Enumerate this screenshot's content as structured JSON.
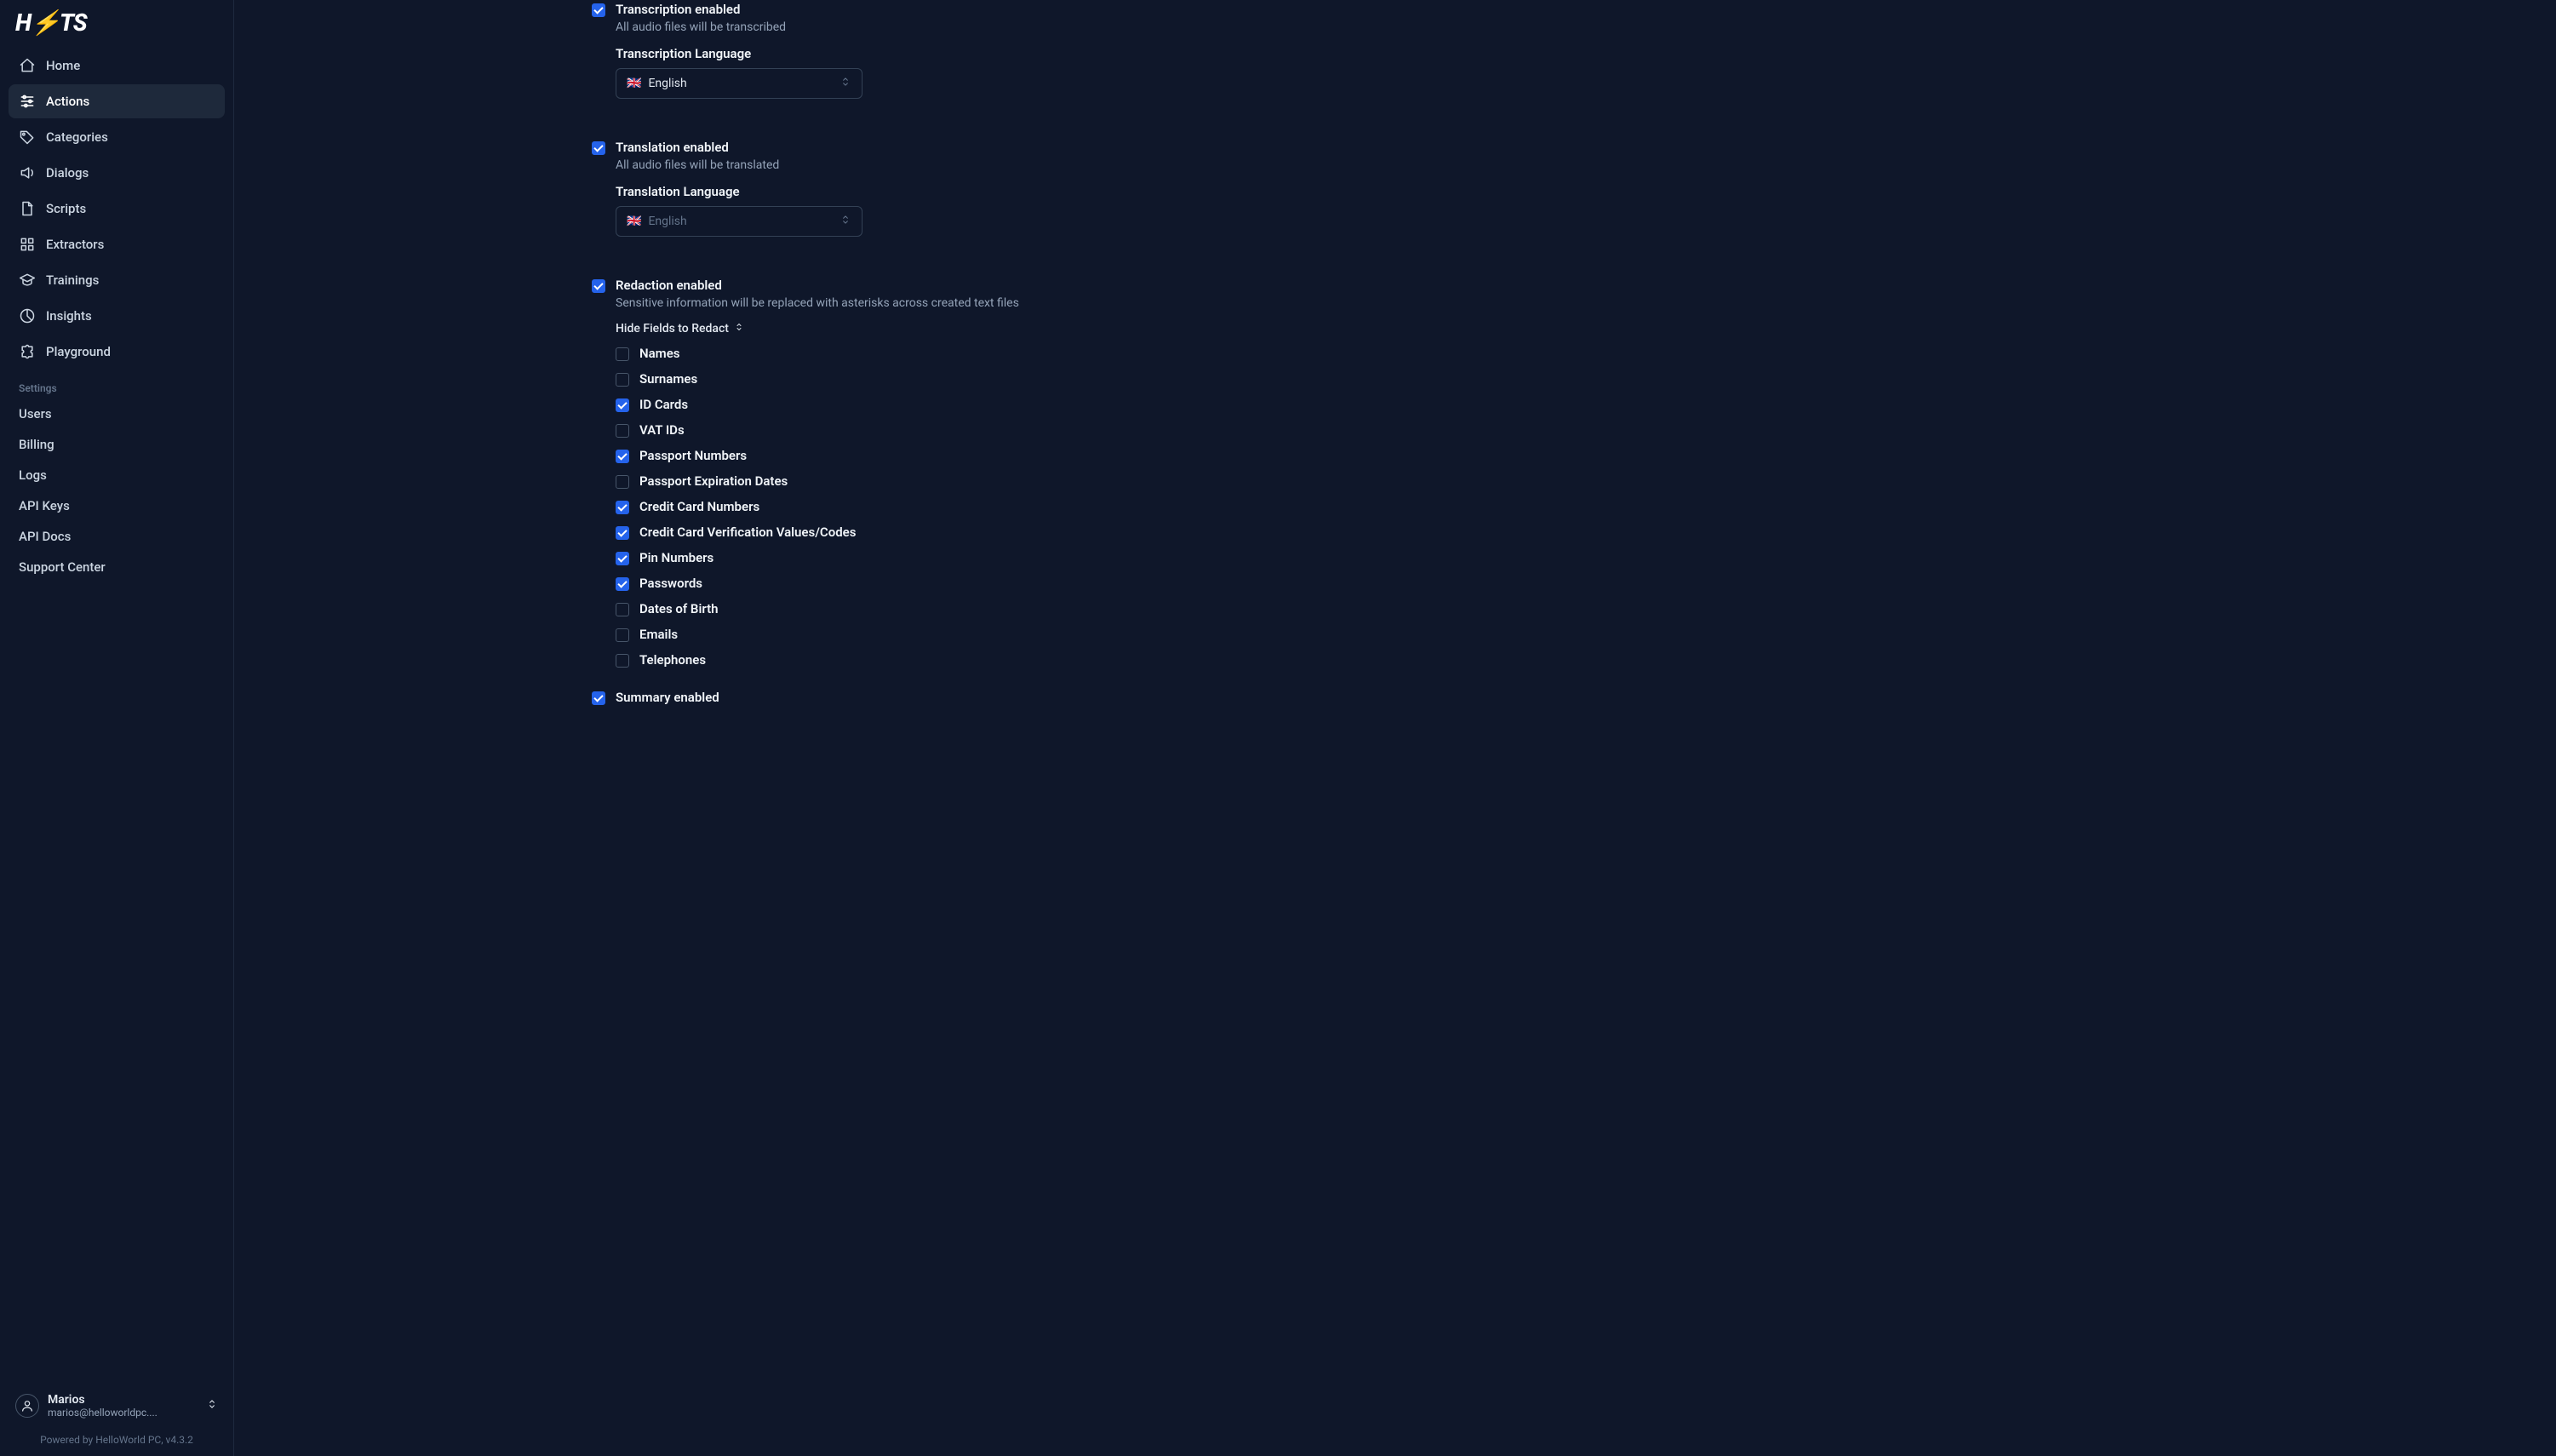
{
  "logo": "H⚡TS",
  "sidebar": {
    "main": [
      {
        "label": "Home",
        "icon": "home-icon",
        "active": false
      },
      {
        "label": "Actions",
        "icon": "sliders-icon",
        "active": true
      },
      {
        "label": "Categories",
        "icon": "tag-icon",
        "active": false
      },
      {
        "label": "Dialogs",
        "icon": "speaker-icon",
        "active": false
      },
      {
        "label": "Scripts",
        "icon": "file-icon",
        "active": false
      },
      {
        "label": "Extractors",
        "icon": "grid-icon",
        "active": false
      },
      {
        "label": "Trainings",
        "icon": "graduation-icon",
        "active": false
      },
      {
        "label": "Insights",
        "icon": "chart-icon",
        "active": false
      },
      {
        "label": "Playground",
        "icon": "puzzle-icon",
        "active": false
      }
    ],
    "settings_title": "Settings",
    "settings": [
      {
        "label": "Users"
      },
      {
        "label": "Billing"
      },
      {
        "label": "Logs"
      },
      {
        "label": "API Keys"
      },
      {
        "label": "API Docs"
      },
      {
        "label": "Support Center"
      }
    ],
    "account": {
      "name": "Marios",
      "email": "marios@helloworldpc...."
    },
    "footer": "Powered by HelloWorld PC, v4.3.2"
  },
  "form": {
    "transcription": {
      "label": "Transcription enabled",
      "sub": "All audio files will be transcribed",
      "checked": true,
      "lang_label": "Transcription Language",
      "lang_flag": "🇬🇧",
      "lang_value": "English"
    },
    "translation": {
      "label": "Translation enabled",
      "sub": "All audio files will be translated",
      "checked": true,
      "lang_label": "Translation Language",
      "lang_flag": "🇬🇧",
      "lang_value": "English"
    },
    "redaction": {
      "label": "Redaction enabled",
      "sub": "Sensitive information will be replaced with asterisks across created text files",
      "checked": true,
      "toggle_label": "Hide Fields to Redact",
      "fields": [
        {
          "label": "Names",
          "checked": false
        },
        {
          "label": "Surnames",
          "checked": false
        },
        {
          "label": "ID Cards",
          "checked": true
        },
        {
          "label": "VAT IDs",
          "checked": false
        },
        {
          "label": "Passport Numbers",
          "checked": true
        },
        {
          "label": "Passport Expiration Dates",
          "checked": false
        },
        {
          "label": "Credit Card Numbers",
          "checked": true
        },
        {
          "label": "Credit Card Verification Values/Codes",
          "checked": true
        },
        {
          "label": "Pin Numbers",
          "checked": true
        },
        {
          "label": "Passwords",
          "checked": true
        },
        {
          "label": "Dates of Birth",
          "checked": false
        },
        {
          "label": "Emails",
          "checked": false
        },
        {
          "label": "Telephones",
          "checked": false
        }
      ]
    },
    "summary": {
      "label": "Summary enabled",
      "checked": true
    }
  }
}
